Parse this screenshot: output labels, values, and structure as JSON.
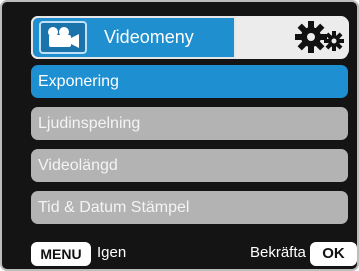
{
  "header": {
    "title": "Videomeny",
    "video_icon": "video-camera-icon",
    "settings_icon": "gears-icon"
  },
  "menu": {
    "items": [
      {
        "label": "Exponering",
        "selected": true
      },
      {
        "label": "Ljudinspelning",
        "selected": false
      },
      {
        "label": "Videolängd",
        "selected": false
      },
      {
        "label": "Tid & Datum Stämpel",
        "selected": false
      }
    ]
  },
  "footer": {
    "menu_key": "MENU",
    "menu_action": "Igen",
    "ok_action": "Bekräfta",
    "ok_key": "OK"
  },
  "colors": {
    "selected": "#1e8fd1",
    "unselected": "#b3b3b3",
    "background": "#141414"
  }
}
